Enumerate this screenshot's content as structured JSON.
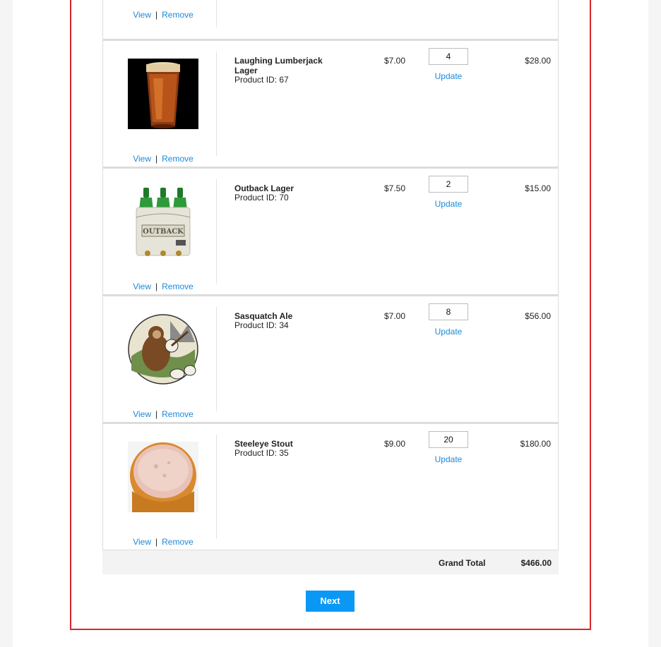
{
  "cart": {
    "partial_row": {
      "view_label": "View",
      "remove_label": "Remove"
    },
    "items": [
      {
        "name": "Laughing Lumberjack Lager",
        "product_id": "Product ID: 67",
        "price": "$7.00",
        "quantity": "4",
        "update_label": "Update",
        "subtotal": "$28.00",
        "view_label": "View",
        "remove_label": "Remove",
        "image": "amber-lager-glass"
      },
      {
        "name": "Outback Lager",
        "product_id": "Product ID: 70",
        "price": "$7.50",
        "quantity": "2",
        "update_label": "Update",
        "subtotal": "$15.00",
        "view_label": "View",
        "remove_label": "Remove",
        "image": "outback-six-pack"
      },
      {
        "name": "Sasquatch Ale",
        "product_id": "Product ID: 34",
        "price": "$7.00",
        "quantity": "8",
        "update_label": "Update",
        "subtotal": "$56.00",
        "view_label": "View",
        "remove_label": "Remove",
        "image": "sasquatch-banjo-label"
      },
      {
        "name": "Steeleye Stout",
        "product_id": "Product ID: 35",
        "price": "$9.00",
        "quantity": "20",
        "update_label": "Update",
        "subtotal": "$180.00",
        "view_label": "View",
        "remove_label": "Remove",
        "image": "foamy-glass"
      }
    ],
    "grand_total_label": "Grand Total",
    "grand_total": "$466.00"
  },
  "actions": {
    "next_label": "Next"
  },
  "colors": {
    "link": "#1a8ad8",
    "button": "#0a98f5",
    "highlight_border": "#d9262a"
  }
}
